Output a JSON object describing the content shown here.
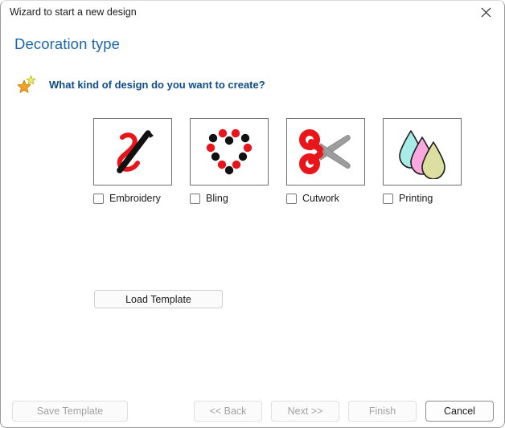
{
  "window": {
    "title": "Wizard to start a new design",
    "close_icon": "close-icon"
  },
  "header": {
    "heading": "Decoration type"
  },
  "question": {
    "icon": "stars-icon",
    "text": "What kind of design do you want to create?"
  },
  "options": [
    {
      "id": "embroidery",
      "label": "Embroidery",
      "icon": "embroidery-needle-thread-icon",
      "checked": false
    },
    {
      "id": "bling",
      "label": "Bling",
      "icon": "bling-heart-dots-icon",
      "checked": false
    },
    {
      "id": "cutwork",
      "label": "Cutwork",
      "icon": "scissors-icon",
      "checked": false
    },
    {
      "id": "printing",
      "label": "Printing",
      "icon": "ink-droplets-icon",
      "checked": false
    }
  ],
  "template": {
    "load_label": "Load Template"
  },
  "footer": {
    "save_template_label": "Save Template",
    "back_label": "<< Back",
    "next_label": "Next >>",
    "finish_label": "Finish",
    "cancel_label": "Cancel"
  },
  "colors": {
    "heading_blue": "#1b66b0",
    "question_blue": "#0f4c8a",
    "accent_red": "#e8151a",
    "scissors_gray": "#9d9d9d",
    "droplet_cyan": "#a8ece8",
    "droplet_pink": "#f9a8e0",
    "droplet_khaki": "#dcdfa0",
    "star_gold": "#f2a21c",
    "star_yellow": "#e5e85a"
  }
}
